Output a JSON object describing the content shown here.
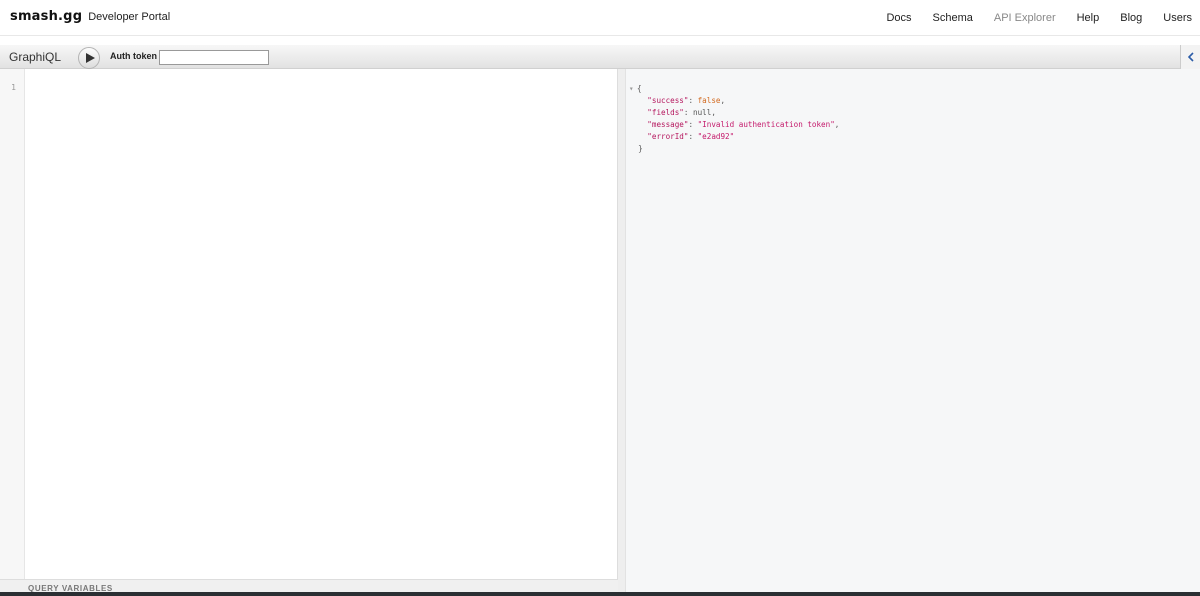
{
  "brand": {
    "logo": "smash.gg",
    "subtitle": "Developer Portal"
  },
  "nav": {
    "links": [
      "Docs",
      "Schema",
      "API Explorer",
      "Help",
      "Blog",
      "Users"
    ]
  },
  "toolbar": {
    "title": "GraphiQL",
    "auth_label": "Auth token",
    "auth_value": ""
  },
  "editor": {
    "line_number": "1",
    "variables_label": "QUERY VARIABLES"
  },
  "result": {
    "open": "{",
    "close": "}",
    "fields": [
      {
        "key": "\"success\"",
        "value": "false",
        "type": "bool"
      },
      {
        "key": "\"fields\"",
        "value": "null",
        "type": "null"
      },
      {
        "key": "\"message\"",
        "value": "\"Invalid authentication token\"",
        "type": "string"
      },
      {
        "key": "\"errorId\"",
        "value": "\"e2ad92\"",
        "type": "string"
      }
    ]
  },
  "colors": {
    "json_key": "#b5175e",
    "json_string": "#c4196b",
    "json_bool": "#d2691e",
    "doc_chevron": "#2b5ca8"
  },
  "icons": {
    "run": "play-icon",
    "docs": "chevron-left-icon",
    "fold": "fold-arrow-icon"
  }
}
